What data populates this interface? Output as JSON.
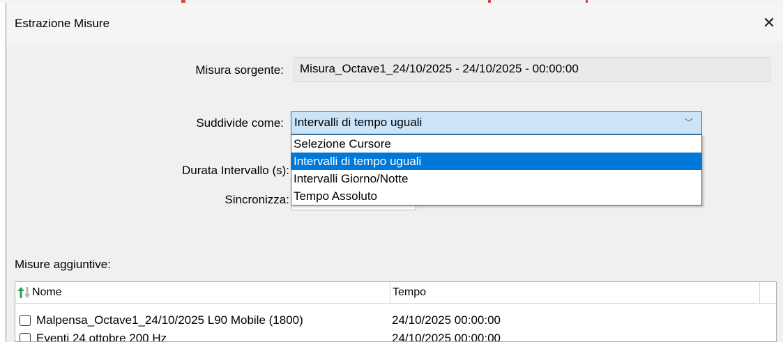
{
  "window": {
    "title": "Estrazione Misure"
  },
  "form": {
    "source_label": "Misura sorgente:",
    "source_value": "Misura_Octave1_24/10/2025 - 24/10/2025 - 00:00:00",
    "split_label": "Suddivide come:",
    "split_value": "Intervalli di tempo uguali",
    "duration_label": "Durata Intervallo (s):",
    "sync_label": "Sincronizza:"
  },
  "dropdown": {
    "options": [
      "Selezione Cursore",
      "Intervalli di tempo uguali",
      "Intervalli Giorno/Notte",
      "Tempo Assoluto"
    ],
    "selected_index": 1
  },
  "list": {
    "label": "Misure aggiuntive:",
    "columns": [
      "Nome",
      "Tempo"
    ],
    "rows": [
      {
        "name": "Malpensa_Octave1_24/10/2025 L90 Mobile (1800)",
        "time": "24/10/2025 00:00:00",
        "checked": false
      },
      {
        "name": "Eventi 24 ottobre 200 Hz",
        "time": "24/10/2025 00:00:00",
        "checked": false
      }
    ]
  },
  "colors": {
    "accent": "#0078d7",
    "selected_bg": "#cce4f7",
    "sort_up": "#2e9e57"
  }
}
